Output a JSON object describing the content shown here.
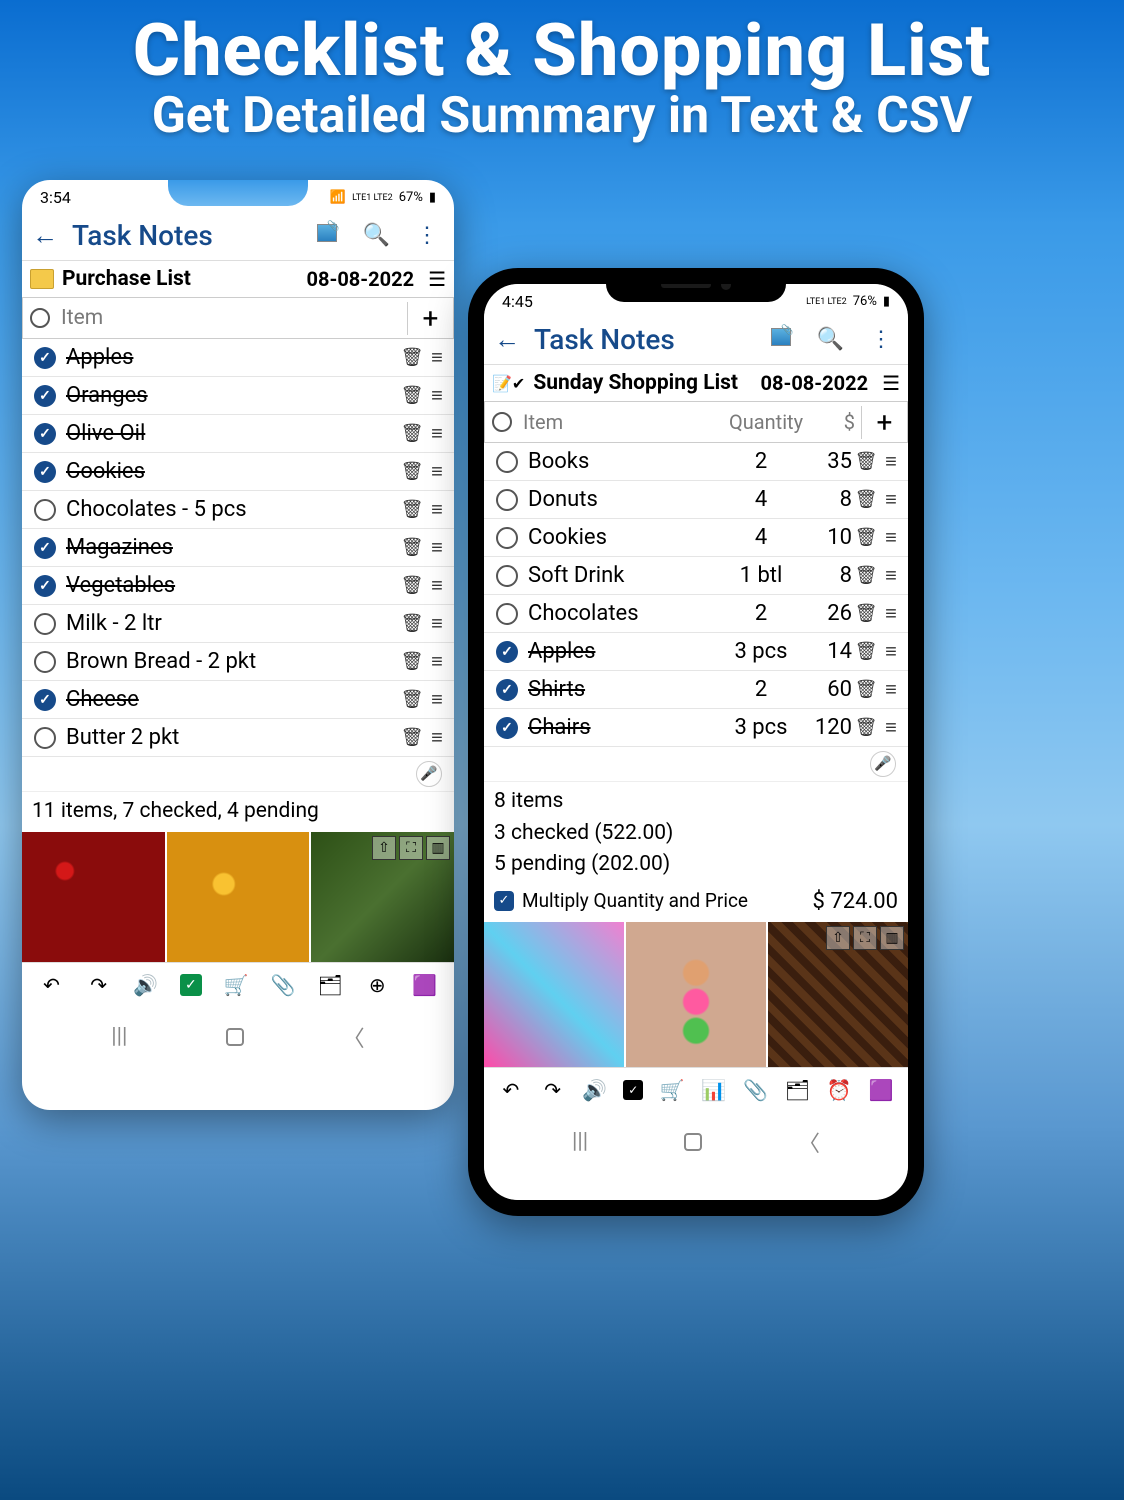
{
  "promo": {
    "title": "Checklist & Shopping List",
    "subtitle": "Get Detailed Summary in Text & CSV"
  },
  "left": {
    "status": {
      "time": "3:54",
      "battery": "67%",
      "signal": "LTE1 LTE2"
    },
    "header": {
      "title": "Task Notes"
    },
    "note": {
      "title": "Purchase List",
      "date": "08-08-2022"
    },
    "columns": {
      "item": "Item"
    },
    "items": [
      {
        "name": "Apples",
        "checked": true
      },
      {
        "name": "Oranges",
        "checked": true
      },
      {
        "name": "Olive Oil",
        "checked": true
      },
      {
        "name": "Cookies",
        "checked": true
      },
      {
        "name": "Chocolates - 5 pcs",
        "checked": false
      },
      {
        "name": "Magazines",
        "checked": true
      },
      {
        "name": "Vegetables",
        "checked": true
      },
      {
        "name": "Milk - 2 ltr",
        "checked": false
      },
      {
        "name": "Brown Bread - 2 pkt",
        "checked": false
      },
      {
        "name": "Cheese",
        "checked": true
      },
      {
        "name": "Butter 2 pkt",
        "checked": false
      }
    ],
    "summary": "11 items, 7 checked, 4 pending"
  },
  "right": {
    "status": {
      "time": "4:45",
      "battery": "76%",
      "signal": "LTE1 LTE2"
    },
    "header": {
      "title": "Task Notes"
    },
    "note": {
      "title": "Sunday Shopping List",
      "date": "08-08-2022"
    },
    "columns": {
      "item": "Item",
      "qty": "Quantity",
      "price": "$"
    },
    "items": [
      {
        "name": "Books",
        "qty": "2",
        "price": "35",
        "checked": false
      },
      {
        "name": "Donuts",
        "qty": "4",
        "price": "8",
        "checked": false
      },
      {
        "name": "Cookies",
        "qty": "4",
        "price": "10",
        "checked": false
      },
      {
        "name": "Soft Drink",
        "qty": "1 btl",
        "price": "8",
        "checked": false
      },
      {
        "name": "Chocolates",
        "qty": "2",
        "price": "26",
        "checked": false
      },
      {
        "name": "Apples",
        "qty": "3 pcs",
        "price": "14",
        "checked": true
      },
      {
        "name": "Shirts",
        "qty": "2",
        "price": "60",
        "checked": true
      },
      {
        "name": "Chairs",
        "qty": "3 pcs",
        "price": "120",
        "checked": true
      }
    ],
    "summary": {
      "line1": "8 items",
      "line2": "3 checked (522.00)",
      "line3": "5 pending (202.00)",
      "multiply_label": "Multiply Quantity and Price",
      "total": "$ 724.00"
    }
  }
}
